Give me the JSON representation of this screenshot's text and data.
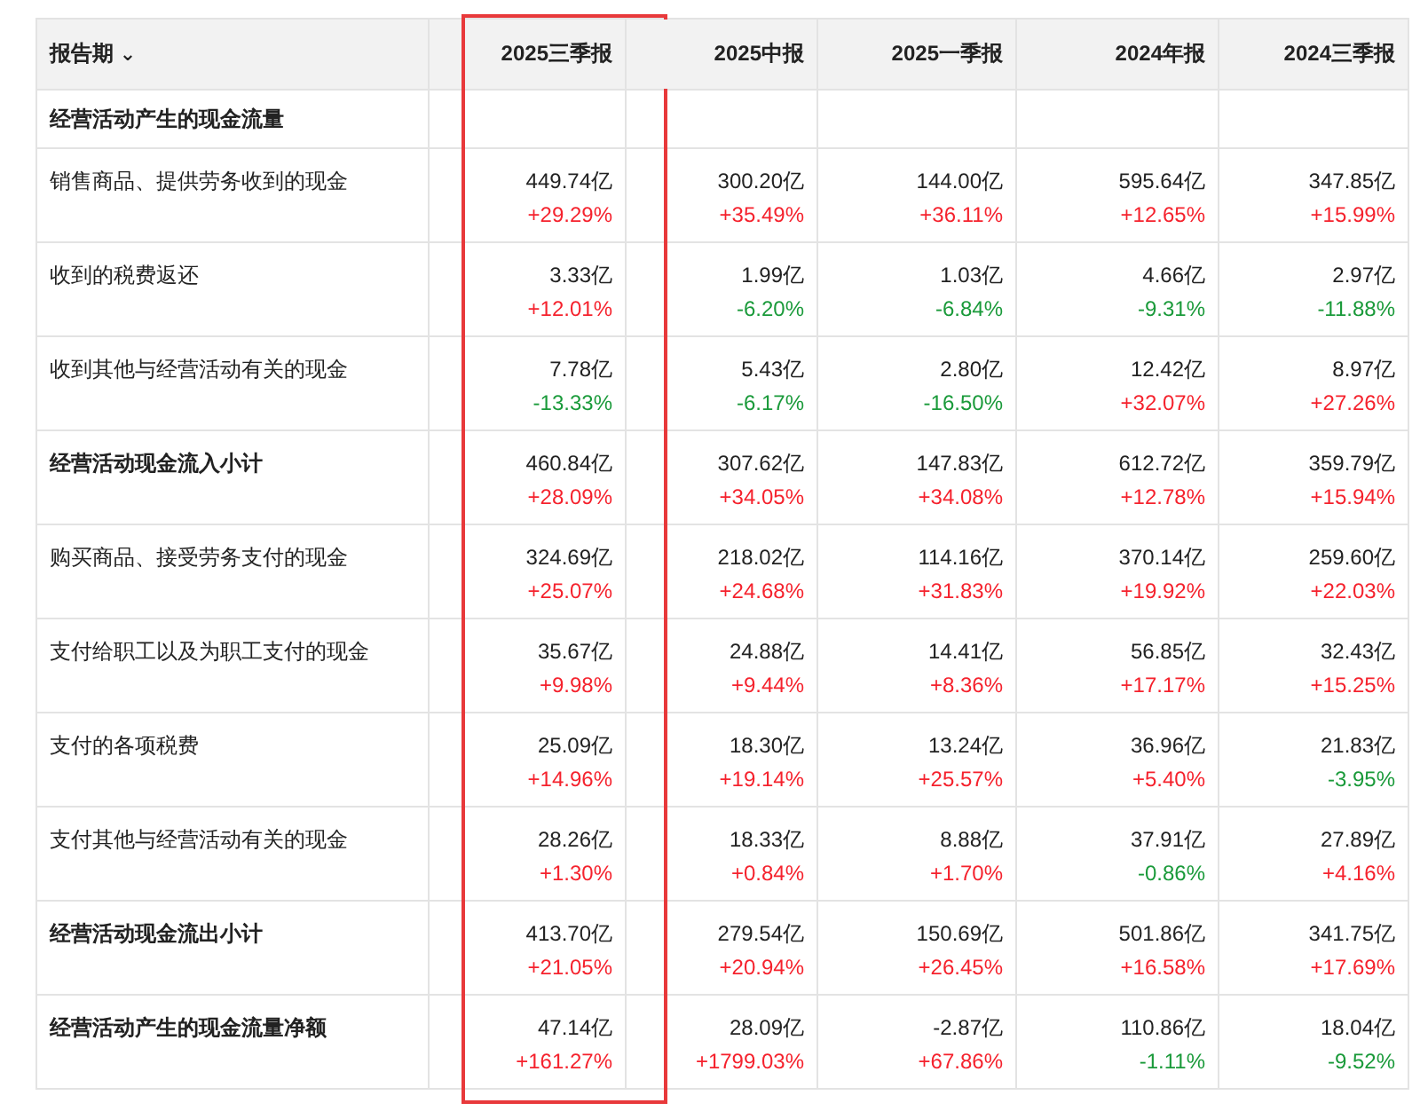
{
  "table": {
    "period_label": "报告期",
    "period_caret": "⌄",
    "columns": [
      {
        "label": "2025三季报",
        "highlighted": true
      },
      {
        "label": "2025中报",
        "highlighted": false
      },
      {
        "label": "2025一季报",
        "highlighted": false
      },
      {
        "label": "2024年报",
        "highlighted": false
      },
      {
        "label": "2024三季报",
        "highlighted": false
      }
    ],
    "rows": [
      {
        "kind": "section",
        "label": "经营活动产生的现金流量"
      },
      {
        "kind": "item",
        "label": "销售商品、提供劳务收到的现金",
        "cells": [
          {
            "value": "449.74亿",
            "change": "+29.29%",
            "color": "#f5222d"
          },
          {
            "value": "300.20亿",
            "change": "+35.49%",
            "color": "#f5222d"
          },
          {
            "value": "144.00亿",
            "change": "+36.11%",
            "color": "#f5222d"
          },
          {
            "value": "595.64亿",
            "change": "+12.65%",
            "color": "#f5222d"
          },
          {
            "value": "347.85亿",
            "change": "+15.99%",
            "color": "#f5222d"
          }
        ]
      },
      {
        "kind": "item",
        "label": "收到的税费返还",
        "cells": [
          {
            "value": "3.33亿",
            "change": "+12.01%",
            "color": "#f5222d"
          },
          {
            "value": "1.99亿",
            "change": "-6.20%",
            "color": "#1a9a3a"
          },
          {
            "value": "1.03亿",
            "change": "-6.84%",
            "color": "#1a9a3a"
          },
          {
            "value": "4.66亿",
            "change": "-9.31%",
            "color": "#1a9a3a"
          },
          {
            "value": "2.97亿",
            "change": "-11.88%",
            "color": "#1a9a3a"
          }
        ]
      },
      {
        "kind": "item",
        "label": "收到其他与经营活动有关的现金",
        "cells": [
          {
            "value": "7.78亿",
            "change": "-13.33%",
            "color": "#1a9a3a"
          },
          {
            "value": "5.43亿",
            "change": "-6.17%",
            "color": "#1a9a3a"
          },
          {
            "value": "2.80亿",
            "change": "-16.50%",
            "color": "#1a9a3a"
          },
          {
            "value": "12.42亿",
            "change": "+32.07%",
            "color": "#f5222d"
          },
          {
            "value": "8.97亿",
            "change": "+27.26%",
            "color": "#f5222d"
          }
        ]
      },
      {
        "kind": "subtotal",
        "label": "经营活动现金流入小计",
        "cells": [
          {
            "value": "460.84亿",
            "change": "+28.09%",
            "color": "#f5222d"
          },
          {
            "value": "307.62亿",
            "change": "+34.05%",
            "color": "#f5222d"
          },
          {
            "value": "147.83亿",
            "change": "+34.08%",
            "color": "#f5222d"
          },
          {
            "value": "612.72亿",
            "change": "+12.78%",
            "color": "#f5222d"
          },
          {
            "value": "359.79亿",
            "change": "+15.94%",
            "color": "#f5222d"
          }
        ]
      },
      {
        "kind": "item",
        "label": "购买商品、接受劳务支付的现金",
        "cells": [
          {
            "value": "324.69亿",
            "change": "+25.07%",
            "color": "#f5222d"
          },
          {
            "value": "218.02亿",
            "change": "+24.68%",
            "color": "#f5222d"
          },
          {
            "value": "114.16亿",
            "change": "+31.83%",
            "color": "#f5222d"
          },
          {
            "value": "370.14亿",
            "change": "+19.92%",
            "color": "#f5222d"
          },
          {
            "value": "259.60亿",
            "change": "+22.03%",
            "color": "#f5222d"
          }
        ]
      },
      {
        "kind": "item",
        "label": "支付给职工以及为职工支付的现金",
        "cells": [
          {
            "value": "35.67亿",
            "change": "+9.98%",
            "color": "#f5222d"
          },
          {
            "value": "24.88亿",
            "change": "+9.44%",
            "color": "#f5222d"
          },
          {
            "value": "14.41亿",
            "change": "+8.36%",
            "color": "#f5222d"
          },
          {
            "value": "56.85亿",
            "change": "+17.17%",
            "color": "#f5222d"
          },
          {
            "value": "32.43亿",
            "change": "+15.25%",
            "color": "#f5222d"
          }
        ]
      },
      {
        "kind": "item",
        "label": "支付的各项税费",
        "cells": [
          {
            "value": "25.09亿",
            "change": "+14.96%",
            "color": "#f5222d"
          },
          {
            "value": "18.30亿",
            "change": "+19.14%",
            "color": "#f5222d"
          },
          {
            "value": "13.24亿",
            "change": "+25.57%",
            "color": "#f5222d"
          },
          {
            "value": "36.96亿",
            "change": "+5.40%",
            "color": "#f5222d"
          },
          {
            "value": "21.83亿",
            "change": "-3.95%",
            "color": "#1a9a3a"
          }
        ]
      },
      {
        "kind": "item",
        "label": "支付其他与经营活动有关的现金",
        "cells": [
          {
            "value": "28.26亿",
            "change": "+1.30%",
            "color": "#f5222d"
          },
          {
            "value": "18.33亿",
            "change": "+0.84%",
            "color": "#f5222d"
          },
          {
            "value": "8.88亿",
            "change": "+1.70%",
            "color": "#f5222d"
          },
          {
            "value": "37.91亿",
            "change": "-0.86%",
            "color": "#1a9a3a"
          },
          {
            "value": "27.89亿",
            "change": "+4.16%",
            "color": "#f5222d"
          }
        ]
      },
      {
        "kind": "subtotal",
        "label": "经营活动现金流出小计",
        "cells": [
          {
            "value": "413.70亿",
            "change": "+21.05%",
            "color": "#f5222d"
          },
          {
            "value": "279.54亿",
            "change": "+20.94%",
            "color": "#f5222d"
          },
          {
            "value": "150.69亿",
            "change": "+26.45%",
            "color": "#f5222d"
          },
          {
            "value": "501.86亿",
            "change": "+16.58%",
            "color": "#f5222d"
          },
          {
            "value": "341.75亿",
            "change": "+17.69%",
            "color": "#f5222d"
          }
        ]
      },
      {
        "kind": "subtotal",
        "label": "经营活动产生的现金流量净额",
        "cells": [
          {
            "value": "47.14亿",
            "change": "+161.27%",
            "color": "#f5222d"
          },
          {
            "value": "28.09亿",
            "change": "+1799.03%",
            "color": "#f5222d"
          },
          {
            "value": "-2.87亿",
            "change": "+67.86%",
            "color": "#f5222d"
          },
          {
            "value": "110.86亿",
            "change": "-1.11%",
            "color": "#1a9a3a"
          },
          {
            "value": "18.04亿",
            "change": "-9.52%",
            "color": "#1a9a3a"
          }
        ]
      }
    ]
  }
}
